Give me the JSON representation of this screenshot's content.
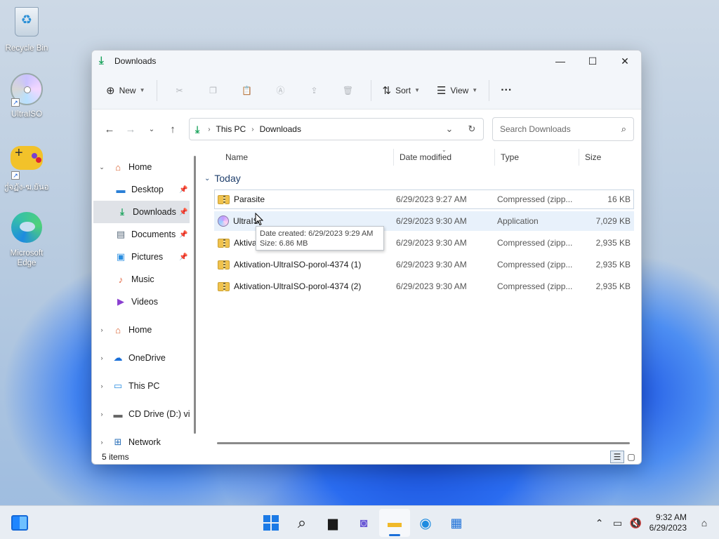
{
  "desktop": {
    "icons": [
      {
        "label": "Recycle Bin",
        "icon": "recycle-bin-icon"
      },
      {
        "label": "UltraISO",
        "icon": "disc-icon"
      },
      {
        "label": "ქจฏัง-ฆ.ยันอ",
        "icon": "gamepad-icon"
      },
      {
        "label": "Microsoft Edge",
        "icon": "edge-icon"
      }
    ]
  },
  "window": {
    "title": "Downloads",
    "controls": {
      "minimize": "—",
      "maximize": "☐",
      "close": "✕"
    }
  },
  "toolbar": {
    "new_label": "New",
    "sort_label": "Sort",
    "view_label": "View",
    "more_label": "···"
  },
  "address": {
    "crumbs": [
      "This PC",
      "Downloads"
    ]
  },
  "search": {
    "placeholder": "Search Downloads"
  },
  "sidebar": {
    "items": [
      {
        "label": "Home",
        "icon": "home-icon"
      },
      {
        "label": "Desktop",
        "icon": "desktop-icon"
      },
      {
        "label": "Downloads",
        "icon": "download-icon"
      },
      {
        "label": "Documents",
        "icon": "documents-icon"
      },
      {
        "label": "Pictures",
        "icon": "pictures-icon"
      },
      {
        "label": "Music",
        "icon": "music-icon"
      },
      {
        "label": "Videos",
        "icon": "videos-icon"
      },
      {
        "label": "Home",
        "icon": "home-icon"
      },
      {
        "label": "OneDrive",
        "icon": "cloud-icon"
      },
      {
        "label": "This PC",
        "icon": "computer-icon"
      },
      {
        "label": "CD Drive (D:) virt",
        "icon": "cd-drive-icon"
      },
      {
        "label": "Network",
        "icon": "network-icon"
      }
    ]
  },
  "columns": {
    "name": "Name",
    "date": "Date modified",
    "type": "Type",
    "size": "Size"
  },
  "group": {
    "label": "Today"
  },
  "files": [
    {
      "name": "Parasite",
      "date": "6/29/2023 9:27 AM",
      "type": "Compressed (zipp...",
      "size": "16 KB",
      "icon": "zip-folder-icon"
    },
    {
      "name": "UltraIS",
      "date": "6/29/2023 9:30 AM",
      "type": "Application",
      "size": "7,029 KB",
      "icon": "ultraiso-app-icon"
    },
    {
      "name": "Aktivat",
      "date": "6/29/2023 9:30 AM",
      "type": "Compressed (zipp...",
      "size": "2,935 KB",
      "icon": "zip-folder-icon"
    },
    {
      "name": "Aktivation-UltraISO-porol-4374 (1)",
      "date": "6/29/2023 9:30 AM",
      "type": "Compressed (zipp...",
      "size": "2,935 KB",
      "icon": "zip-folder-icon"
    },
    {
      "name": "Aktivation-UltraISO-porol-4374 (2)",
      "date": "6/29/2023 9:30 AM",
      "type": "Compressed (zipp...",
      "size": "2,935 KB",
      "icon": "zip-folder-icon"
    }
  ],
  "tooltip": {
    "line1": "Date created: 6/29/2023 9:29 AM",
    "line2": "Size: 6.86 MB"
  },
  "status": {
    "items_count": "5 items"
  },
  "taskbar": {
    "time": "9:32 AM",
    "date": "6/29/2023"
  }
}
